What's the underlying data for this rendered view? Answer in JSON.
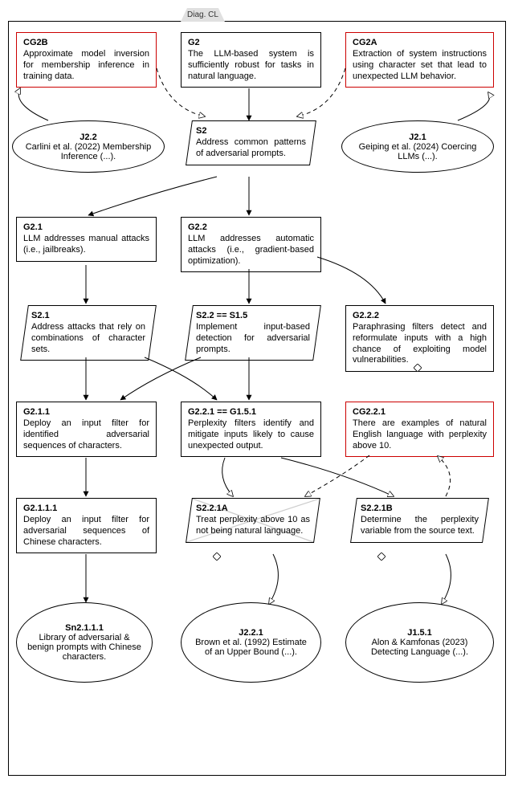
{
  "tab": "Diag. CL",
  "nodes": {
    "CG2B": {
      "title": "CG2B",
      "body": "Approximate model inversion for membership inference in training data."
    },
    "G2": {
      "title": "G2",
      "body": "The LLM-based system is sufficiently robust for tasks in natural language."
    },
    "CG2A": {
      "title": "CG2A",
      "body": "Extraction of system instructions using character set that lead to unexpected LLM behavior."
    },
    "J22": {
      "title": "J2.2",
      "body": "Carlini et al. (2022) Membership Inference (...)."
    },
    "S2": {
      "title": "S2",
      "body": "Address common patterns of adversarial prompts."
    },
    "J21": {
      "title": "J2.1",
      "body": "Geiping et al. (2024) Coercing LLMs (...)."
    },
    "G21": {
      "title": "G2.1",
      "body": "LLM addresses manual attacks (i.e., jailbreaks)."
    },
    "G22": {
      "title": "G2.2",
      "body": "LLM addresses automatic attacks (i.e., gradient-based optimization)."
    },
    "S21": {
      "title": "S2.1",
      "body": "Address attacks that rely on combinations of character sets."
    },
    "S22": {
      "title": "S2.2 == S1.5",
      "body": "Implement input-based detection for adversarial prompts."
    },
    "G222": {
      "title": "G2.2.2",
      "body": "Paraphrasing filters detect and reformulate inputs with a high chance of exploiting model vulnerabilities."
    },
    "G211": {
      "title": "G2.1.1",
      "body": "Deploy an input filter for identified adversarial sequences of characters."
    },
    "G221": {
      "title": "G2.2.1 == G1.5.1",
      "body": "Perplexity filters identify and mitigate inputs likely to cause unexpected output."
    },
    "CG221": {
      "title": "CG2.2.1",
      "body": "There are examples of natural English language with perplexity above 10."
    },
    "G2111": {
      "title": "G2.1.1.1",
      "body": "Deploy an input filter for adversarial sequences of Chinese characters."
    },
    "S221A": {
      "title": "S2.2.1A",
      "body": "Treat perplexity above 10 as not being natural language."
    },
    "S221B": {
      "title": "S2.2.1B",
      "body": "Determine the perplexity variable from the source text."
    },
    "Sn2111": {
      "title": "Sn2.1.1.1",
      "body": "Library of adversarial & benign prompts with Chinese characters."
    },
    "J2211": {
      "title": "J2.2.1",
      "body": "Brown et al. (1992) Estimate of an Upper Bound (...)."
    },
    "J1511": {
      "title": "J1.5.1",
      "body": "Alon & Kamfonas (2023) Detecting Language (...)."
    }
  }
}
